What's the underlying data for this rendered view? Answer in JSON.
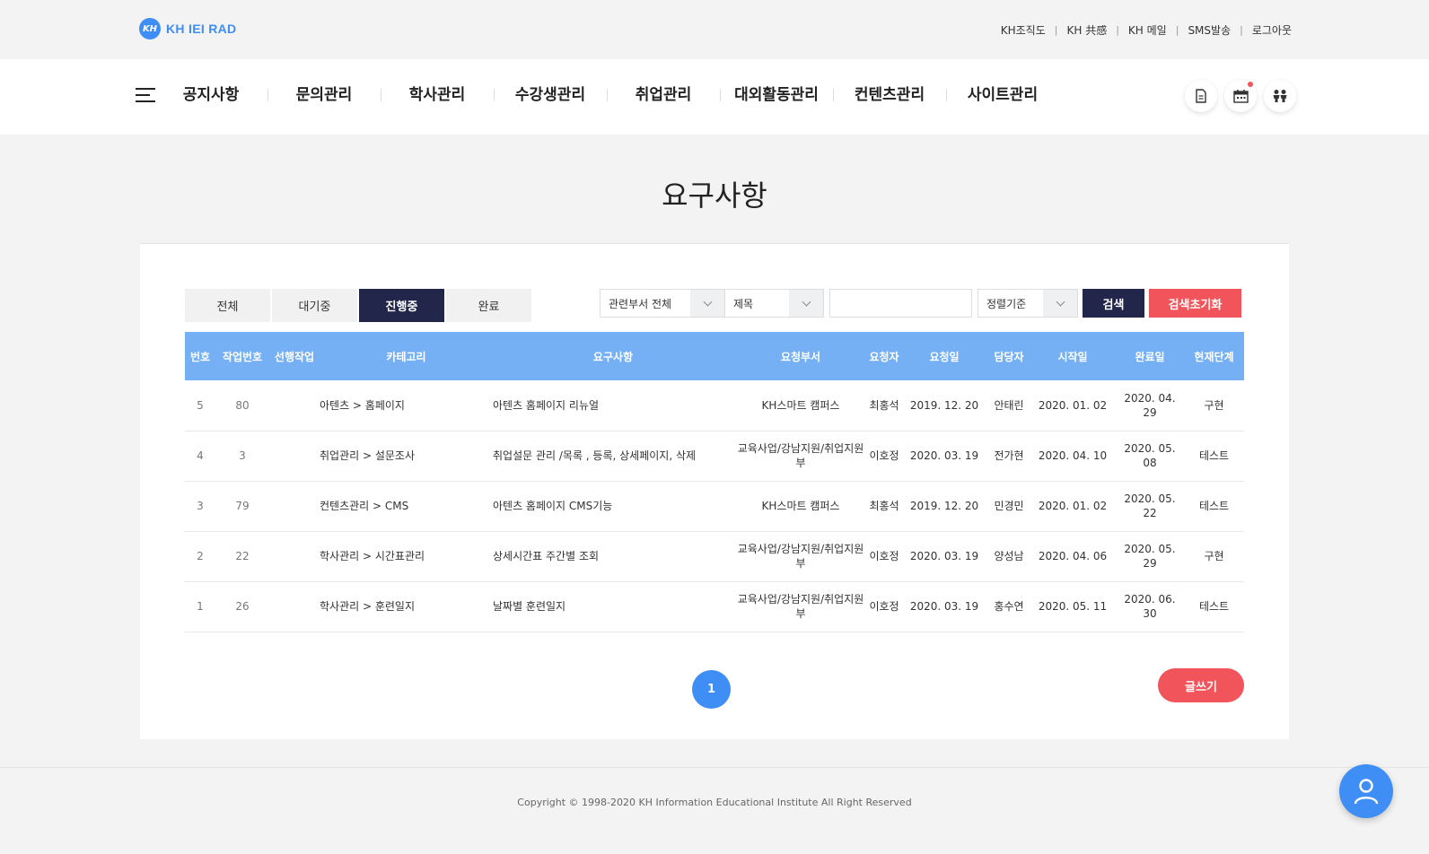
{
  "brand": {
    "logo_mark": "KH",
    "name": "KH IEI RAD"
  },
  "util_links": [
    "KH조직도",
    "KH 共感",
    "KH 메일",
    "SMS발송",
    "로그아웃"
  ],
  "nav": {
    "items": [
      "공지사항",
      "문의관리",
      "학사관리",
      "수강생관리",
      "취업관리",
      "대외활동관리",
      "컨텐츠관리",
      "사이트관리"
    ],
    "quick_icons": [
      "document-icon",
      "calendar-icon",
      "people-icon"
    ]
  },
  "page_title": "요구사항",
  "tabs": [
    {
      "label": "전체",
      "active": false
    },
    {
      "label": "대기중",
      "active": false
    },
    {
      "label": "진행중",
      "active": true
    },
    {
      "label": "완료",
      "active": false
    }
  ],
  "search": {
    "department_select": "관련부서 전체",
    "field_select": "제목",
    "keyword": "",
    "sort_select": "정렬기준",
    "search_label": "검색",
    "reset_label": "검색초기화"
  },
  "table": {
    "headers": [
      "번호",
      "작업번호",
      "선행작업",
      "카테고리",
      "요구사항",
      "요청부서",
      "요청자",
      "요청일",
      "담당자",
      "시작일",
      "완료일",
      "현재단계"
    ],
    "rows": [
      [
        "5",
        "80",
        "",
        "아텐츠 > 홈페이지",
        "아텐츠 홈페이지 리뉴얼",
        "KH스마트 캠퍼스",
        "최홍석",
        "2019. 12. 20",
        "안태린",
        "2020. 01. 02",
        "2020. 04. 29",
        "구현"
      ],
      [
        "4",
        "3",
        "",
        "취업관리 > 설문조사",
        "취업설문 관리 /목록 , 등록, 상세페이지, 삭제",
        "교육사업/강남지원/취업지원부",
        "이호정",
        "2020. 03. 19",
        "전가현",
        "2020. 04. 10",
        "2020. 05. 08",
        "테스트"
      ],
      [
        "3",
        "79",
        "",
        "컨텐츠관리 > CMS",
        "아텐츠 홈페이지 CMS기능",
        "KH스마트 캠퍼스",
        "최홍석",
        "2019. 12. 20",
        "민경민",
        "2020. 01. 02",
        "2020. 05. 22",
        "테스트"
      ],
      [
        "2",
        "22",
        "",
        "학사관리 > 시간표관리",
        "상세시간표 주간별 조회",
        "교육사업/강남지원/취업지원부",
        "이호정",
        "2020. 03. 19",
        "양성남",
        "2020. 04. 06",
        "2020. 05. 29",
        "구현"
      ],
      [
        "1",
        "26",
        "",
        "학사관리 > 훈련일지",
        "날짜별 훈련일지",
        "교육사업/강남지원/취업지원부",
        "이호정",
        "2020. 03. 19",
        "홍수연",
        "2020. 05. 11",
        "2020. 06. 30",
        "테스트"
      ]
    ]
  },
  "pagination": {
    "current_page": "1"
  },
  "write_label": "글쓰기",
  "footer": {
    "copyright": "Copyright © 1998-2020 KH Information Educational Institute All Right Reserved"
  },
  "colors": {
    "accent_blue": "#3f8ef5",
    "header_blue": "#76b0f4",
    "navy": "#22264a",
    "coral": "#f2545b"
  }
}
